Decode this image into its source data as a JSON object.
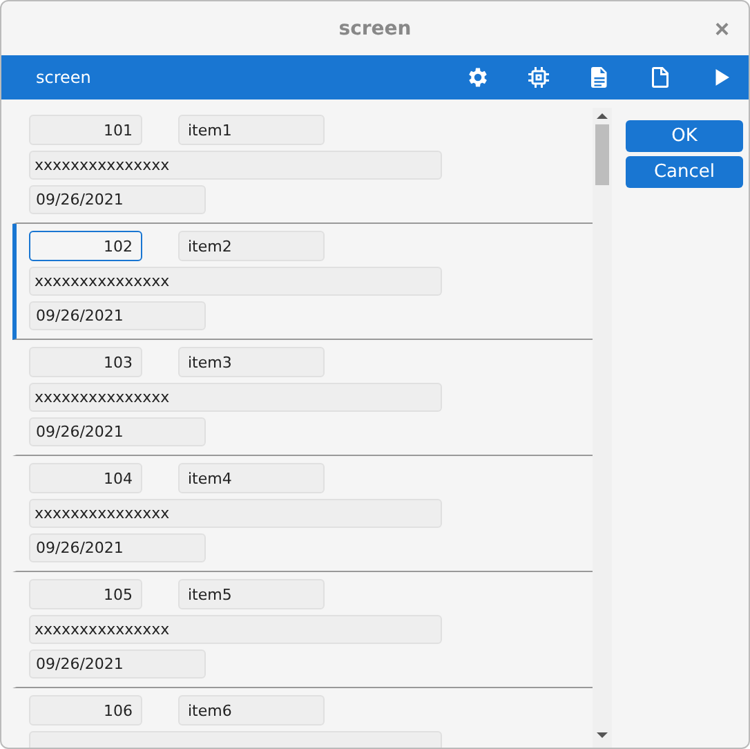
{
  "window": {
    "title": "screen",
    "close": "×"
  },
  "toolbar": {
    "title": "screen"
  },
  "records": [
    {
      "number": "101",
      "name": "item1",
      "description": "xxxxxxxxxxxxxxx",
      "date": "09/26/2021",
      "selected": false
    },
    {
      "number": "102",
      "name": "item2",
      "description": "xxxxxxxxxxxxxxx",
      "date": "09/26/2021",
      "selected": true
    },
    {
      "number": "103",
      "name": "item3",
      "description": "xxxxxxxxxxxxxxx",
      "date": "09/26/2021",
      "selected": false
    },
    {
      "number": "104",
      "name": "item4",
      "description": "xxxxxxxxxxxxxxx",
      "date": "09/26/2021",
      "selected": false
    },
    {
      "number": "105",
      "name": "item5",
      "description": "xxxxxxxxxxxxxxx",
      "date": "09/26/2021",
      "selected": false
    },
    {
      "number": "106",
      "name": "item6",
      "selected": false
    }
  ],
  "buttons": [
    "OK",
    "Cancel"
  ]
}
